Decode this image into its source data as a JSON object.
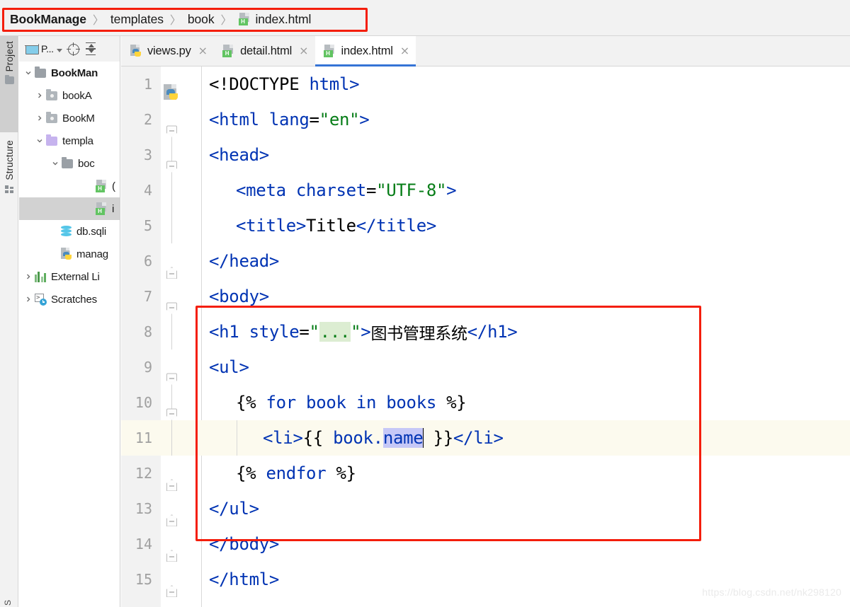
{
  "breadcrumb": {
    "separator": "〉",
    "items": [
      {
        "label": "BookManage",
        "icon": "",
        "bold": true
      },
      {
        "label": "templates",
        "icon": "",
        "bold": false
      },
      {
        "label": "book",
        "icon": "",
        "bold": false
      },
      {
        "label": "index.html",
        "icon": "html-file-icon",
        "bold": false
      }
    ]
  },
  "tool_strip": {
    "tabs": [
      {
        "label": "Project",
        "icon": "folder-icon",
        "selected": true
      },
      {
        "label": "Structure",
        "icon": "structure-icon",
        "selected": false
      }
    ],
    "bottom_label": "S"
  },
  "project_panel": {
    "toolbar": {
      "project_selector_label": "P...",
      "project_selector_icon": "project-window-icon",
      "scroll_from_source_icon": "crosshair-target-icon",
      "collapse_all_icon": "collapse-all-icon"
    },
    "tree": [
      {
        "label": "BookMan",
        "icon": "folder-icon",
        "arrow": "down",
        "depth": 0,
        "bold": true,
        "selected": false
      },
      {
        "label": "bookA",
        "icon": "module-folder-icon",
        "arrow": "right",
        "depth": 1,
        "bold": false,
        "selected": false
      },
      {
        "label": "BookM",
        "icon": "module-folder-icon",
        "arrow": "right",
        "depth": 1,
        "bold": false,
        "selected": false
      },
      {
        "label": "templa",
        "icon": "templates-folder-icon",
        "arrow": "down",
        "depth": 1,
        "bold": false,
        "selected": false
      },
      {
        "label": "boc",
        "icon": "folder-icon",
        "arrow": "down",
        "depth": 2,
        "bold": false,
        "selected": false
      },
      {
        "label": "(",
        "icon": "html-file-icon",
        "arrow": "none",
        "depth": 3,
        "bold": false,
        "selected": false
      },
      {
        "label": "i",
        "icon": "html-file-icon",
        "arrow": "none",
        "depth": 3,
        "bold": false,
        "selected": true
      },
      {
        "label": "db.sqli",
        "icon": "database-icon",
        "arrow": "none",
        "depth": 1,
        "bold": false,
        "selected": false
      },
      {
        "label": "manag",
        "icon": "python-file-icon",
        "arrow": "none",
        "depth": 1,
        "bold": false,
        "selected": false
      },
      {
        "label": "External Li",
        "icon": "external-libraries-icon",
        "arrow": "right",
        "depth": 0,
        "bold": false,
        "selected": false
      },
      {
        "label": "Scratches",
        "icon": "scratches-icon",
        "arrow": "right",
        "depth": 0,
        "bold": false,
        "selected": false
      }
    ]
  },
  "editor": {
    "tabs": [
      {
        "label": "views.py",
        "icon": "python-file-icon",
        "active": false,
        "close": "×"
      },
      {
        "label": "detail.html",
        "icon": "html-file-icon",
        "active": false,
        "close": "×"
      },
      {
        "label": "index.html",
        "icon": "html-file-icon",
        "active": true,
        "close": "×"
      }
    ],
    "html_badge_letter": "H",
    "current_line": 11,
    "lines": [
      {
        "num": "1",
        "gutter_icon": "python-file-icon",
        "fold": "none"
      },
      {
        "num": "2",
        "gutter_icon": "",
        "fold": "open"
      },
      {
        "num": "3",
        "gutter_icon": "",
        "fold": "open"
      },
      {
        "num": "4",
        "gutter_icon": "",
        "fold": "none"
      },
      {
        "num": "5",
        "gutter_icon": "",
        "fold": "none"
      },
      {
        "num": "6",
        "gutter_icon": "",
        "fold": "close"
      },
      {
        "num": "7",
        "gutter_icon": "",
        "fold": "open"
      },
      {
        "num": "8",
        "gutter_icon": "",
        "fold": "none"
      },
      {
        "num": "9",
        "gutter_icon": "",
        "fold": "open"
      },
      {
        "num": "10",
        "gutter_icon": "",
        "fold": "open"
      },
      {
        "num": "11",
        "gutter_icon": "",
        "fold": "none"
      },
      {
        "num": "12",
        "gutter_icon": "",
        "fold": "close"
      },
      {
        "num": "13",
        "gutter_icon": "",
        "fold": "close"
      },
      {
        "num": "14",
        "gutter_icon": "",
        "fold": "close"
      },
      {
        "num": "15",
        "gutter_icon": "",
        "fold": "close"
      }
    ],
    "code_text": {
      "l1": "<!DOCTYPE html>",
      "l2": "<html lang=\"en\">",
      "l3": "<head>",
      "l4": "<meta charset=\"UTF-8\">",
      "l5": "<title>Title</title>",
      "l6": "</head>",
      "l7": "<body>",
      "l8": "<h1 style=\"...\">图书管理系统</h1>",
      "l9": "<ul>",
      "l10": "{% for book in books %}",
      "l11": "<li>{{ book.name }}</li>",
      "l12": "{% endfor %}",
      "l13": "</ul>",
      "l14": "</body>",
      "l15": "</html>",
      "collapsed_attr": "...",
      "selected_token": "name"
    }
  },
  "annotations": {
    "color": "#f41e0c",
    "breadcrumb_box": "highlight-breadcrumb",
    "code_box": "highlight-template-block"
  },
  "watermark": {
    "text": "https://blog.csdn.net/nk298120"
  },
  "colors": {
    "tag": "#0033b3",
    "attr_value": "#067d17",
    "text": "#000000",
    "current_line_bg": "#fcfaee",
    "selection_bg": "#c6c8f7",
    "collapsed_bg": "#dcedd2",
    "accent_blue": "#3574d6",
    "annotation_red": "#f41e0c"
  }
}
